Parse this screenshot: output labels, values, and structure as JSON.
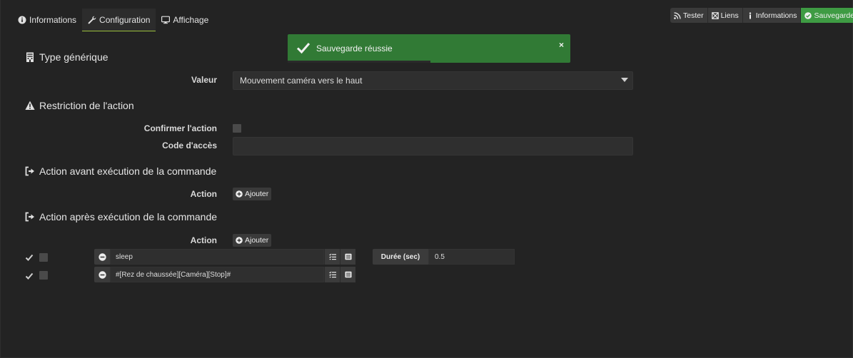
{
  "tabs": [
    {
      "label": "Informations",
      "icon": "info-circle-icon"
    },
    {
      "label": "Configuration",
      "icon": "wrench-icon",
      "active": true
    },
    {
      "label": "Affichage",
      "icon": "monitor-icon"
    }
  ],
  "toolbar": {
    "tester": "Tester",
    "liens": "Liens",
    "informations": "Informations",
    "sauvegarder": "Sauvegarder"
  },
  "toast": {
    "message": "Sauvegarde réussie",
    "close": "×"
  },
  "sections": {
    "type_generique": "Type générique",
    "restriction": "Restriction de l'action",
    "avant": "Action avant exécution de la commande",
    "apres": "Action après exécution de la commande"
  },
  "form": {
    "valeur_label": "Valeur",
    "valeur_selected": "Mouvement caméra vers le haut",
    "confirmer_label": "Confirmer l'action",
    "code_label": "Code d'accès",
    "code_value": "",
    "action_label": "Action",
    "ajouter": "Ajouter"
  },
  "actions_after": [
    {
      "command": "sleep",
      "duree_label": "Durée (sec)",
      "duree": "0.5"
    },
    {
      "command": "#[Rez de chaussée][Caméra][Stop]#"
    }
  ],
  "colors": {
    "background": "#232323",
    "accent_green": "#3e9b43",
    "toast_green": "#317a35"
  }
}
